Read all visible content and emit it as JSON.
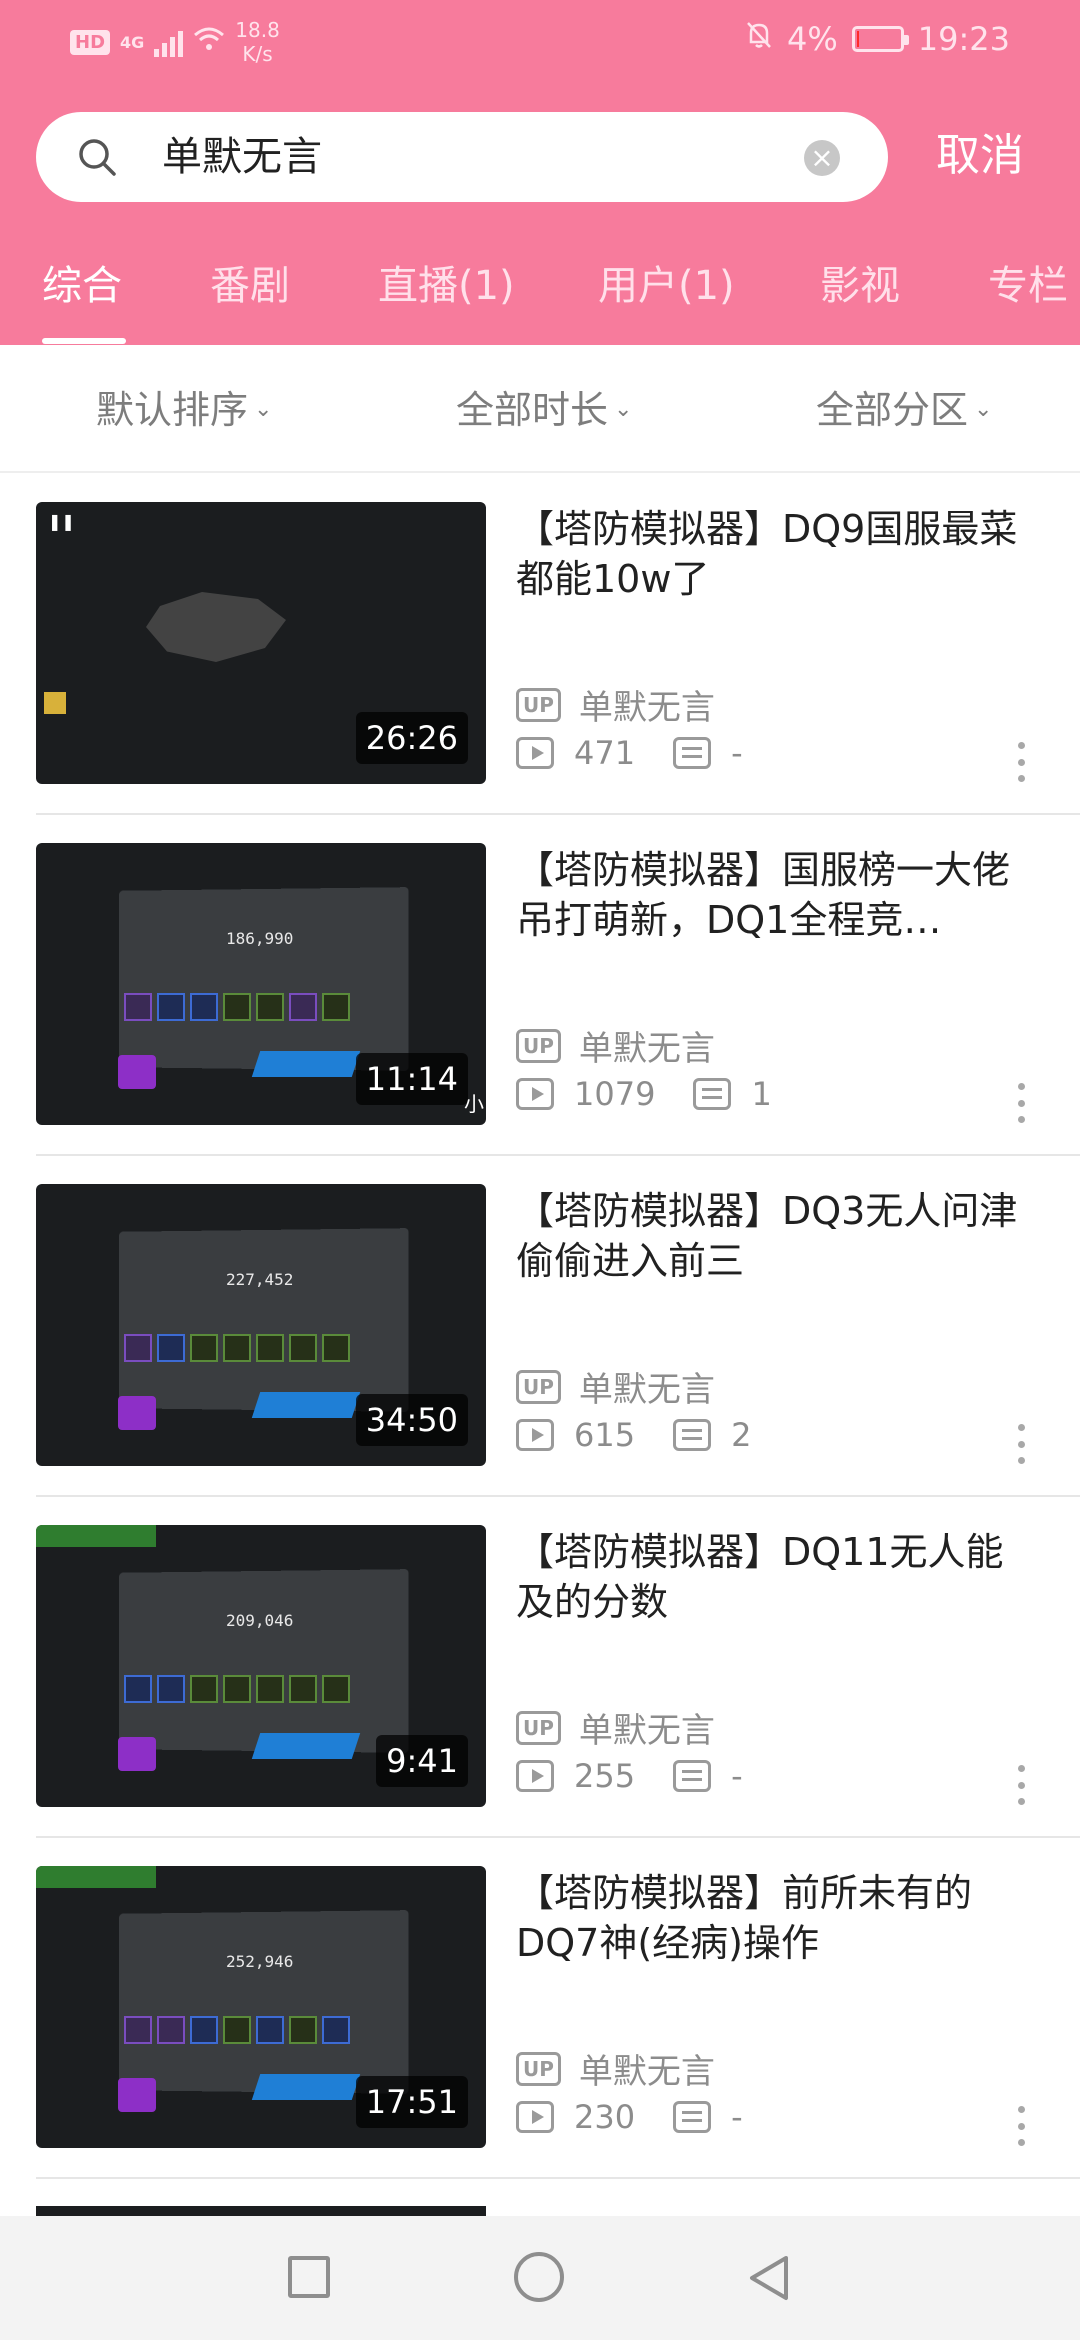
{
  "status_bar": {
    "hd": "HD",
    "network": "4G",
    "speed_value": "18.8",
    "speed_unit": "K/s",
    "battery": "4%",
    "time": "19:23"
  },
  "search": {
    "query": "单默无言",
    "cancel_label": "取消"
  },
  "tabs": [
    "综合",
    "番剧",
    "直播(1)",
    "用户(1)",
    "影视",
    "专栏"
  ],
  "filters": {
    "sort": "默认排序",
    "duration": "全部时长",
    "category": "全部分区"
  },
  "videos": [
    {
      "title": "【塔防模拟器】DQ9国服最菜都能10w了",
      "duration": "26:26",
      "uploader": "单默无言",
      "views": "471",
      "danmaku": "-"
    },
    {
      "title": "【塔防模拟器】国服榜一大佬吊打萌新，DQ1全程竞…",
      "duration": "11:14",
      "uploader": "单默无言",
      "views": "1079",
      "danmaku": "1",
      "thumb_text": {
        "score": "186,990",
        "corner": "小"
      }
    },
    {
      "title": "【塔防模拟器】DQ3无人问津偷偷进入前三",
      "duration": "34:50",
      "uploader": "单默无言",
      "views": "615",
      "danmaku": "2",
      "thumb_text": {
        "score": "227,452"
      }
    },
    {
      "title": "【塔防模拟器】DQ11无人能及的分数",
      "duration": "9:41",
      "uploader": "单默无言",
      "views": "255",
      "danmaku": "-",
      "thumb_text": {
        "score": "209,046"
      }
    },
    {
      "title": "【塔防模拟器】前所未有的DQ7神(经病)操作",
      "duration": "17:51",
      "uploader": "单默无言",
      "views": "230",
      "danmaku": "-",
      "thumb_text": {
        "score": "252,946"
      }
    }
  ],
  "up_badge": "UP",
  "colors": {
    "header_pink": "#f77b9c",
    "battery_low": "#ff2a2a"
  }
}
